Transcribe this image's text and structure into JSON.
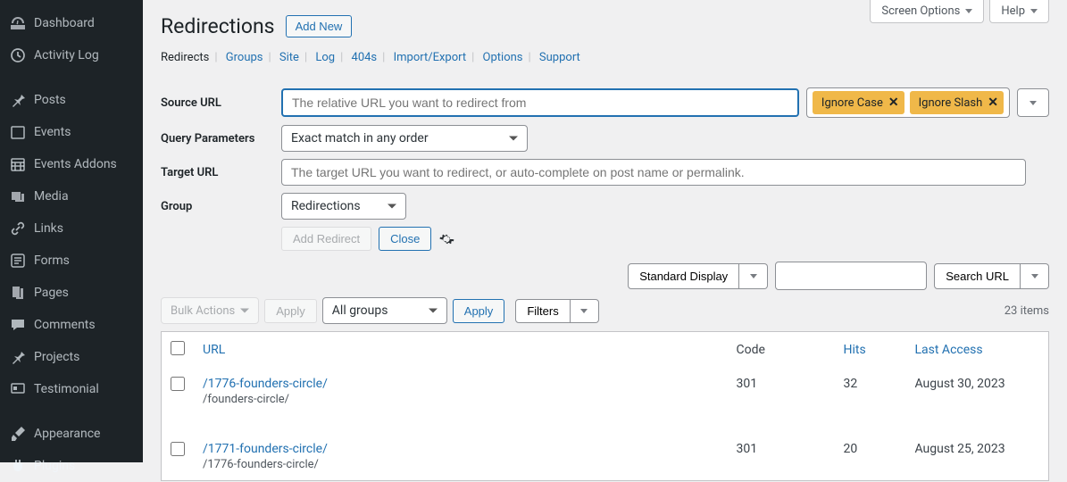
{
  "topControls": {
    "screenOptions": "Screen Options",
    "help": "Help"
  },
  "sidebar": {
    "items": [
      {
        "label": "Dashboard"
      },
      {
        "label": "Activity Log"
      },
      {
        "label": "Posts"
      },
      {
        "label": "Events"
      },
      {
        "label": "Events Addons"
      },
      {
        "label": "Media"
      },
      {
        "label": "Links"
      },
      {
        "label": "Forms"
      },
      {
        "label": "Pages"
      },
      {
        "label": "Comments"
      },
      {
        "label": "Projects"
      },
      {
        "label": "Testimonial"
      },
      {
        "label": "Appearance"
      },
      {
        "label": "Plugins"
      }
    ]
  },
  "header": {
    "title": "Redirections",
    "addNew": "Add New"
  },
  "tabs": [
    "Redirects",
    "Groups",
    "Site",
    "Log",
    "404s",
    "Import/Export",
    "Options",
    "Support"
  ],
  "form": {
    "sourceLabel": "Source URL",
    "sourcePlaceholder": "The relative URL you want to redirect from",
    "tags": {
      "ignoreCase": "Ignore Case",
      "ignoreSlash": "Ignore Slash"
    },
    "queryLabel": "Query Parameters",
    "querySelected": "Exact match in any order",
    "targetLabel": "Target URL",
    "targetPlaceholder": "The target URL you want to redirect, or auto-complete on post name or permalink.",
    "groupLabel": "Group",
    "groupSelected": "Redirections",
    "addRedirect": "Add Redirect",
    "close": "Close"
  },
  "toolbar": {
    "standardDisplay": "Standard Display",
    "searchUrl": "Search URL"
  },
  "listToolbar": {
    "bulkActions": "Bulk Actions",
    "apply": "Apply",
    "allGroups": "All groups",
    "apply2": "Apply",
    "filters": "Filters",
    "itemsCount": "23 items"
  },
  "table": {
    "headers": {
      "url": "URL",
      "code": "Code",
      "hits": "Hits",
      "lastAccess": "Last Access"
    },
    "rows": [
      {
        "url": "/1776-founders-circle/",
        "target": "/founders-circle/",
        "code": "301",
        "hits": "32",
        "lastAccess": "August 30, 2023"
      },
      {
        "url": "/1771-founders-circle/",
        "target": "/1776-founders-circle/",
        "code": "301",
        "hits": "20",
        "lastAccess": "August 25, 2023"
      }
    ]
  }
}
